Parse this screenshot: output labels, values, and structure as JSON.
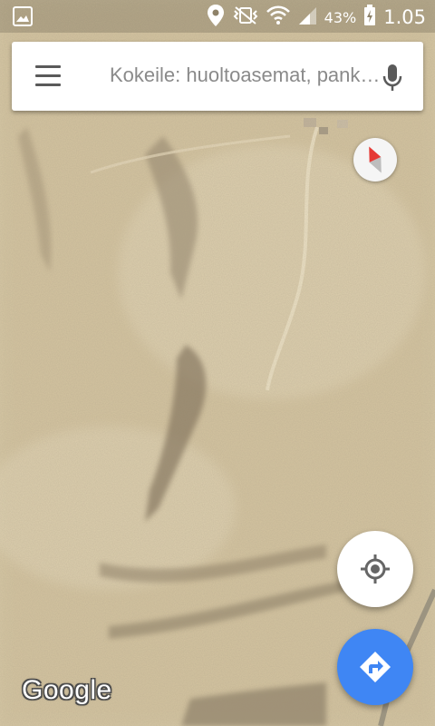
{
  "status_bar": {
    "left_icon": "image-notification-icon",
    "icons": [
      "location-icon",
      "vibrate-off-icon",
      "wifi-icon",
      "signal-icon"
    ],
    "battery_percent": "43%",
    "battery_icon": "battery-charging-icon",
    "time": "1.05"
  },
  "search": {
    "menu_icon": "hamburger-menu-icon",
    "placeholder": "Kokeile: huoltoasemat, pankkiautomaatit",
    "mic_icon": "microphone-icon"
  },
  "map": {
    "type": "satellite",
    "compass_icon": "compass-icon"
  },
  "controls": {
    "locate_icon": "my-location-icon",
    "directions_icon": "directions-icon",
    "directions_color": "#3f86f4"
  },
  "attribution": {
    "logo_text": "Google"
  }
}
